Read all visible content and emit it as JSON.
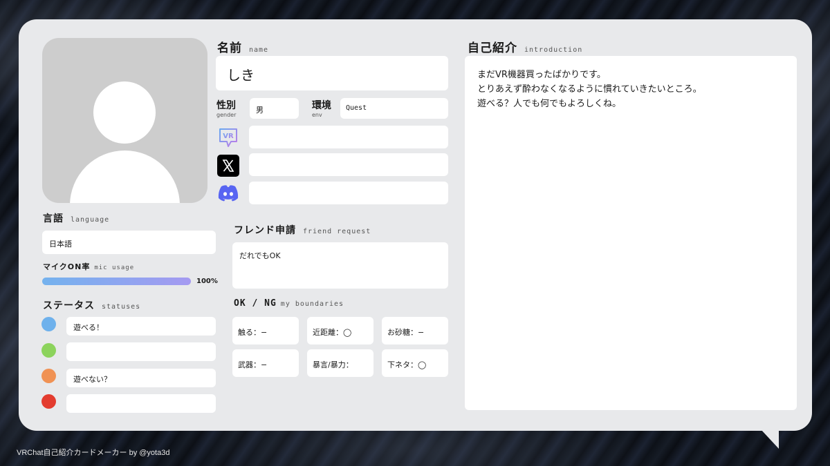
{
  "profile": {
    "name_label": "名前",
    "name_label_en": "name",
    "name_value": "しき",
    "gender_label": "性別",
    "gender_label_en": "gender",
    "gender_value": "男",
    "env_label": "環境",
    "env_label_en": "env",
    "env_value": "Quest",
    "vrchat_value": "",
    "x_value": "",
    "discord_value": ""
  },
  "language": {
    "label": "言語",
    "label_en": "language",
    "value": "日本語"
  },
  "mic": {
    "label": "マイクON率",
    "label_en": "mic usage",
    "percent_text": "100%",
    "percent": 100
  },
  "statuses": {
    "label": "ステータス",
    "label_en": "statuses",
    "items": [
      {
        "color": "#6eb1ec",
        "text": "遊べる！"
      },
      {
        "color": "#8cd35c",
        "text": ""
      },
      {
        "color": "#f09254",
        "text": "遊べない？"
      },
      {
        "color": "#e33c2f",
        "text": ""
      }
    ]
  },
  "friend_request": {
    "label": "フレンド申請",
    "label_en": "friend request",
    "value": "だれでもOK"
  },
  "boundaries": {
    "label": "OK / NG",
    "label_en": "my boundaries",
    "items": [
      {
        "text": "触る：−"
      },
      {
        "text": "近距離：◯"
      },
      {
        "text": "お砂糖：−"
      },
      {
        "text": "武器：−"
      },
      {
        "text": "暴言/暴力："
      },
      {
        "text": "下ネタ：◯"
      }
    ]
  },
  "introduction": {
    "label": "自己紹介",
    "label_en": "introduction",
    "lines": [
      "まだVR機器買ったばかりです。",
      "とりあえず酔わなくなるように慣れていきたいところ。",
      "遊べる？人でも何でもよろしくね。"
    ]
  },
  "icons": {
    "vrchat": "vrchat-icon",
    "x": "x-logo-icon",
    "discord": "discord-icon"
  },
  "footer": "VRChat自己紹介カードメーカー by @yota3d"
}
